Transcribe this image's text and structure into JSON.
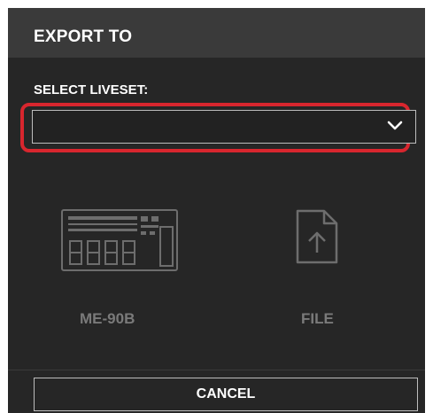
{
  "dialog": {
    "title": "EXPORT TO",
    "select_label": "SELECT LIVESET:",
    "select_value": "",
    "targets": [
      {
        "label": "ME-90B",
        "icon": "me90b-device-icon"
      },
      {
        "label": "FILE",
        "icon": "file-upload-icon"
      }
    ],
    "cancel_label": "CANCEL"
  },
  "colors": {
    "highlight": "#d8262e",
    "header_bg": "#3a3a3a",
    "body_bg": "#262626",
    "disabled_text": "#7a7a7a"
  }
}
